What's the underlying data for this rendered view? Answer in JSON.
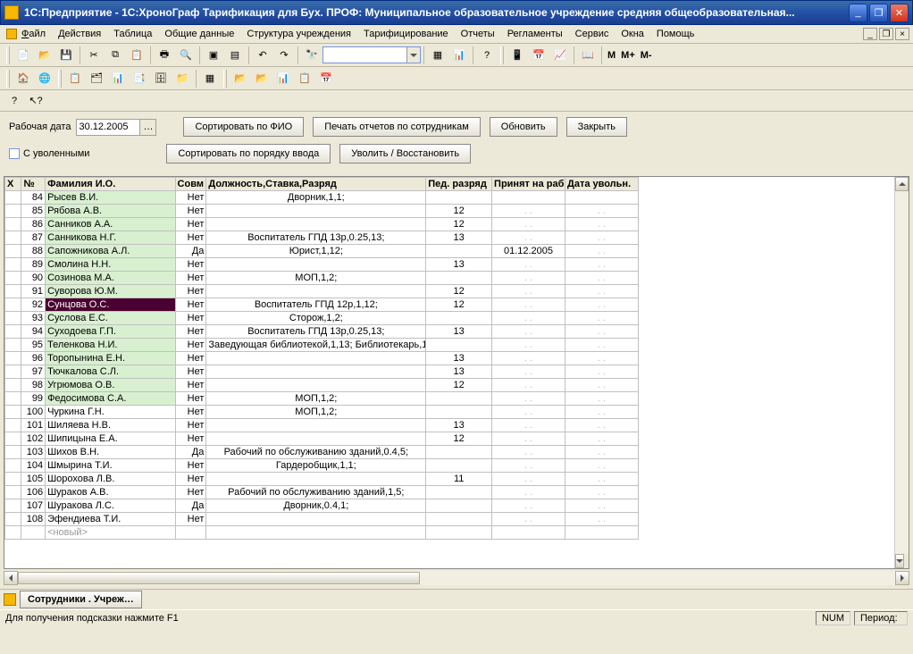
{
  "title": "1С:Предприятие - 1С:ХроноГраф Тарификация для Бух. ПРОФ: Муниципальное образовательное учреждение средняя общеобразовательная...",
  "menus": [
    "Файл",
    "Действия",
    "Таблица",
    "Общие данные",
    "Структура учреждения",
    "Тарифицирование",
    "Отчеты",
    "Регламенты",
    "Сервис",
    "Окна",
    "Помощь"
  ],
  "toolbar3_text": [
    "М",
    "М+",
    "М-"
  ],
  "doc": {
    "date_label": "Рабочая дата",
    "date_value": "30.12.2005",
    "btn_sort_fio": "Сортировать по ФИО",
    "btn_print": "Печать отчетов по сотрудникам",
    "btn_refresh": "Обновить",
    "btn_close": "Закрыть",
    "cb_fired": "С уволенными",
    "btn_sort_order": "Сортировать по порядку ввода",
    "btn_fire": "Уволить / Восстановить"
  },
  "headers": [
    "Х",
    "№",
    "Фамилия И.О.",
    "Совм",
    "Должность,Ставка,Разряд",
    "Пед. разряд",
    "Принят на раб.",
    "Дата увольн."
  ],
  "rows": [
    {
      "n": "84",
      "fio": "Рысев В.И.",
      "g": 1,
      "sovm": "Нет",
      "pos": "Дворник,1,1;",
      "pr": "",
      "d1": "",
      "d2": ""
    },
    {
      "n": "85",
      "fio": "Рябова А.В.",
      "g": 1,
      "sovm": "Нет",
      "pos": "",
      "pr": "12",
      "d1": ".  .",
      "d2": ".  ."
    },
    {
      "n": "86",
      "fio": "Санников А.А.",
      "g": 1,
      "sovm": "Нет",
      "pos": "",
      "pr": "12",
      "d1": ".  .",
      "d2": ".  ."
    },
    {
      "n": "87",
      "fio": "Санникова Н.Г.",
      "g": 1,
      "sovm": "Нет",
      "pos": "Воспитатель ГПД 13р,0.25,13;",
      "pr": "13",
      "d1": ".  .",
      "d2": ".  ."
    },
    {
      "n": "88",
      "fio": "Сапожникова А.Л.",
      "g": 1,
      "sovm": "Да",
      "pos": "Юрист,1,12;",
      "pr": "",
      "d1": "01.12.2005",
      "d2": ".  ."
    },
    {
      "n": "89",
      "fio": "Смолина Н.Н.",
      "g": 1,
      "sovm": "Нет",
      "pos": "",
      "pr": "13",
      "d1": ".  .",
      "d2": ".  ."
    },
    {
      "n": "90",
      "fio": "Созинова М.А.",
      "g": 1,
      "sovm": "Нет",
      "pos": "МОП,1,2;",
      "pr": "",
      "d1": ".  .",
      "d2": ".  ."
    },
    {
      "n": "91",
      "fio": "Суворова Ю.М.",
      "g": 1,
      "sovm": "Нет",
      "pos": "",
      "pr": "12",
      "d1": ".  .",
      "d2": ".  ."
    },
    {
      "n": "92",
      "fio": "Сунцова О.С.",
      "g": 1,
      "sel": 1,
      "sovm": "Нет",
      "pos": "Воспитатель ГПД 12р,1,12;",
      "pr": "12",
      "d1": ".  .",
      "d2": ".  ."
    },
    {
      "n": "93",
      "fio": "Суслова Е.С.",
      "g": 1,
      "sovm": "Нет",
      "pos": "Сторож,1,2;",
      "pr": "",
      "d1": ".  .",
      "d2": ".  ."
    },
    {
      "n": "94",
      "fio": "Суходоева Г.П.",
      "g": 1,
      "sovm": "Нет",
      "pos": "Воспитатель ГПД 13р,0.25,13;",
      "pr": "13",
      "d1": ".  .",
      "d2": ".  ."
    },
    {
      "n": "95",
      "fio": "Теленкова Н.И.",
      "g": 1,
      "sovm": "Нет",
      "pos": "Заведующая библиотекой,1,13; Библиотекарь,1",
      "pr": "",
      "d1": ".  .",
      "d2": ".  ."
    },
    {
      "n": "96",
      "fio": "Торопынина Е.Н.",
      "g": 1,
      "sovm": "Нет",
      "pos": "",
      "pr": "13",
      "d1": ".  .",
      "d2": ".  ."
    },
    {
      "n": "97",
      "fio": "Тючкалова С.Л.",
      "g": 1,
      "sovm": "Нет",
      "pos": "",
      "pr": "13",
      "d1": ".  .",
      "d2": ".  ."
    },
    {
      "n": "98",
      "fio": "Угрюмова О.В.",
      "g": 1,
      "sovm": "Нет",
      "pos": "",
      "pr": "12",
      "d1": ".  .",
      "d2": ".  ."
    },
    {
      "n": "99",
      "fio": "Федосимова С.А.",
      "g": 1,
      "sovm": "Нет",
      "pos": "МОП,1,2;",
      "pr": "",
      "d1": ".  .",
      "d2": ".  ."
    },
    {
      "n": "100",
      "fio": "Чуркина Г.Н.",
      "g": 0,
      "sovm": "Нет",
      "pos": "МОП,1,2;",
      "pr": "",
      "d1": ".  .",
      "d2": ".  ."
    },
    {
      "n": "101",
      "fio": "Шиляева Н.В.",
      "g": 0,
      "sovm": "Нет",
      "pos": "",
      "pr": "13",
      "d1": ".  .",
      "d2": ".  ."
    },
    {
      "n": "102",
      "fio": "Шипицына Е.А.",
      "g": 0,
      "sovm": "Нет",
      "pos": "",
      "pr": "12",
      "d1": ".  .",
      "d2": ".  ."
    },
    {
      "n": "103",
      "fio": "Шихов В.Н.",
      "g": 0,
      "sovm": "Да",
      "pos": "Рабочий по обслуживанию зданий,0.4,5;",
      "pr": "",
      "d1": ".  .",
      "d2": ".  ."
    },
    {
      "n": "104",
      "fio": "Шмырина Т.И.",
      "g": 0,
      "sovm": "Нет",
      "pos": "Гардеробщик,1,1;",
      "pr": "",
      "d1": ".  .",
      "d2": ".  ."
    },
    {
      "n": "105",
      "fio": "Шорохова Л.В.",
      "g": 0,
      "sovm": "Нет",
      "pos": "",
      "pr": "11",
      "d1": ".  .",
      "d2": ".  ."
    },
    {
      "n": "106",
      "fio": "Шураков А.В.",
      "g": 0,
      "sovm": "Нет",
      "pos": "Рабочий по обслуживанию зданий,1,5;",
      "pr": "",
      "d1": ".  .",
      "d2": ".  ."
    },
    {
      "n": "107",
      "fio": "Шуракова Л.С.",
      "g": 0,
      "sovm": "Да",
      "pos": "Дворник,0.4,1;",
      "pr": "",
      "d1": ".  .",
      "d2": ".  ."
    },
    {
      "n": "108",
      "fio": "Эфендиева Т.И.",
      "g": 0,
      "sovm": "Нет",
      "pos": "",
      "pr": "",
      "d1": ".  .",
      "d2": ".  ."
    }
  ],
  "new_row": "<новый>",
  "doctab": "Сотрудники . Учреж…",
  "status_hint": "Для получения подсказки нажмите F1",
  "status_num": "NUM",
  "status_period": "Период:"
}
